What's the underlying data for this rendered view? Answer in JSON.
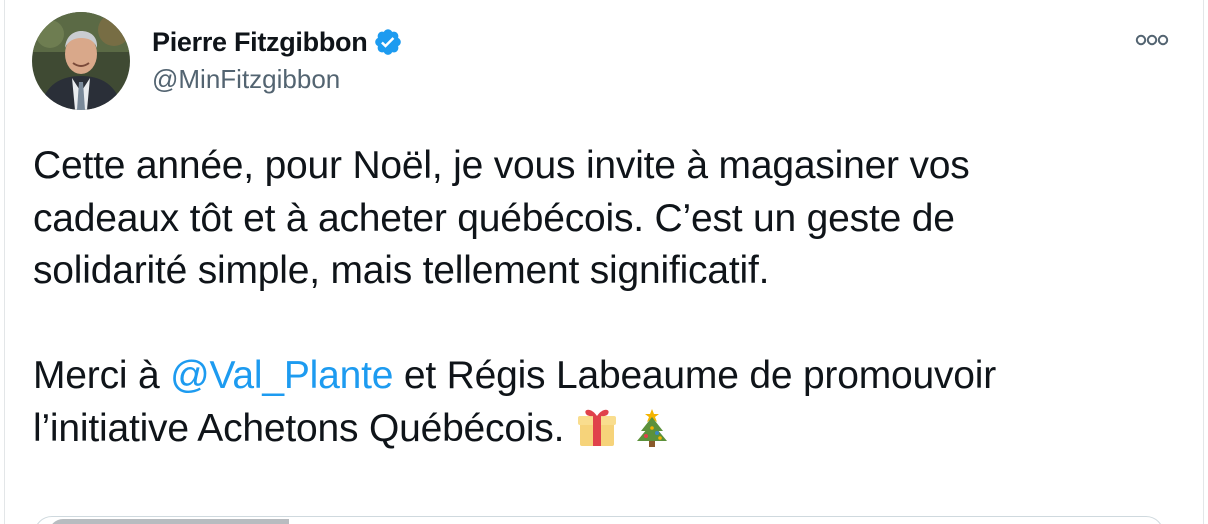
{
  "tweet": {
    "author": {
      "display_name": "Pierre Fitzgibbon",
      "handle": "@MinFitzgibbon",
      "verified": true,
      "avatar_icon": "profile-photo-avatar"
    },
    "more_icon": "more-options-icon",
    "text": {
      "line1": "Cette année, pour Noël, je vous invite à magasiner vos",
      "line2": "cadeaux tôt et à acheter québécois. C’est un geste de",
      "line3": "solidarité simple, mais tellement significatif.",
      "line4_prefix": "Merci à ",
      "line4_mention": "@Val_Plante",
      "line4_suffix": " et Régis Labeaume de promouvoir",
      "line5": "l’initiative Achetons Québécois.",
      "emoji_1": "gift-emoji",
      "emoji_2": "christmas-tree-emoji"
    },
    "colors": {
      "text": "#0f1419",
      "secondary": "#536471",
      "link": "#1d9bf0",
      "verified_badge": "#1d9bf0"
    }
  }
}
